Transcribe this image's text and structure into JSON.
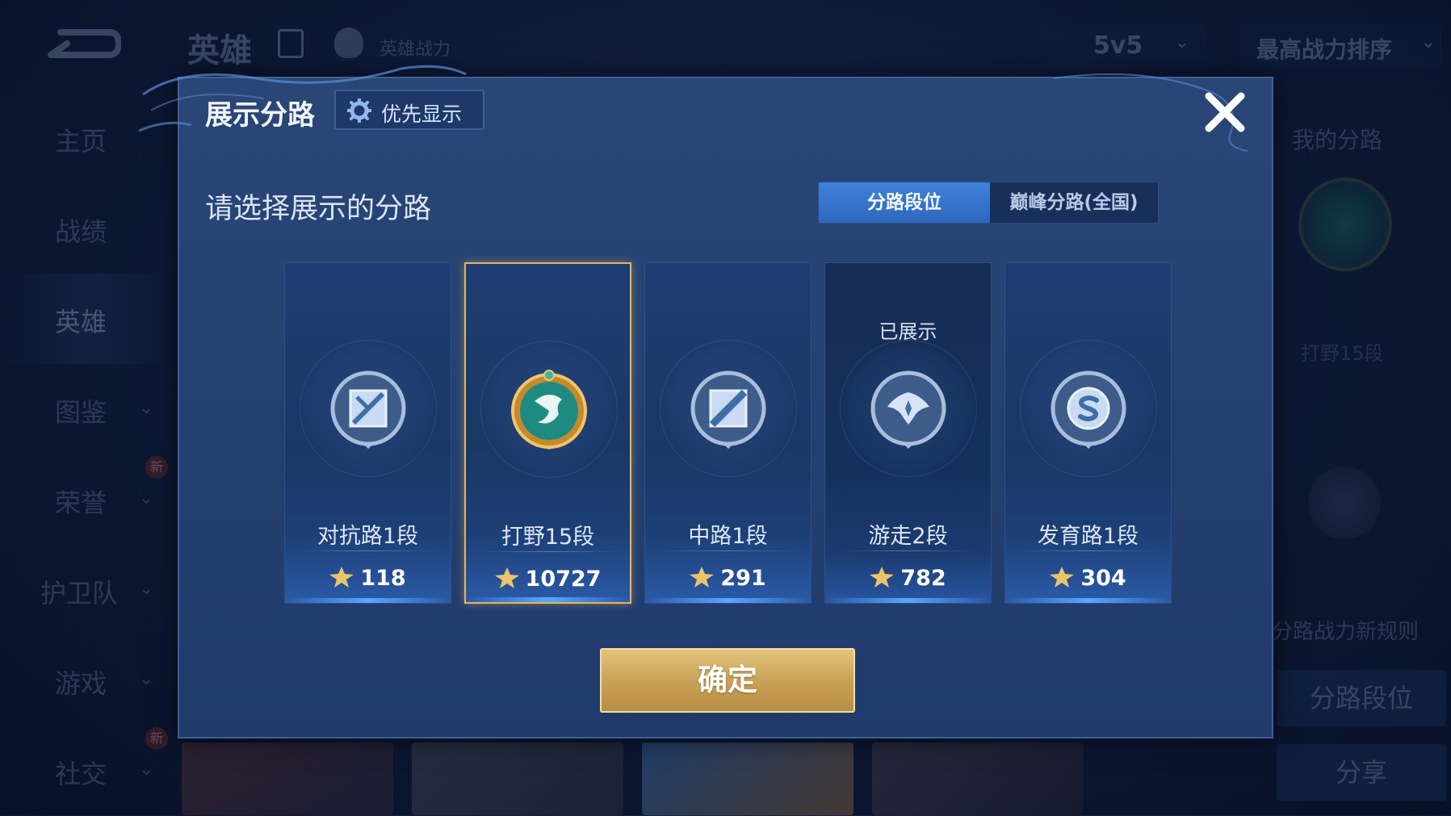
{
  "background": {
    "top_title": "英雄",
    "top_subtitle": "英雄战力",
    "mode_select": "5v5",
    "sort_select": "最高战力排序",
    "nav": [
      {
        "label": "主页",
        "chevron": false,
        "new": false,
        "active": false
      },
      {
        "label": "战绩",
        "chevron": false,
        "new": false,
        "active": false
      },
      {
        "label": "英雄",
        "chevron": false,
        "new": false,
        "active": true
      },
      {
        "label": "图鉴",
        "chevron": true,
        "new": false,
        "active": false
      },
      {
        "label": "荣誉",
        "chevron": true,
        "new": true,
        "active": false
      },
      {
        "label": "护卫队",
        "chevron": true,
        "new": false,
        "active": false
      },
      {
        "label": "游戏",
        "chevron": true,
        "new": false,
        "active": false
      },
      {
        "label": "社交",
        "chevron": true,
        "new": true,
        "active": false
      }
    ],
    "new_badge": "新",
    "right_panel": {
      "title": "我的分路",
      "rank": "打野15段",
      "rule_text": "分路战力新规则",
      "lane_rank_button": "分路段位",
      "share_button": "分享"
    }
  },
  "modal": {
    "title": "展示分路",
    "priority_button": "优先显示",
    "prompt": "请选择展示的分路",
    "tabs": [
      {
        "label": "分路段位",
        "active": true
      },
      {
        "label": "巅峰分路(全国)",
        "active": false
      }
    ],
    "shown_label": "已展示",
    "lanes": [
      {
        "name": "对抗路1段",
        "score": "118",
        "icon": "clash-lane-icon",
        "selected": false,
        "shown": false
      },
      {
        "name": "打野15段",
        "score": "10727",
        "icon": "jungle-dragon-icon",
        "selected": true,
        "shown": false
      },
      {
        "name": "中路1段",
        "score": "291",
        "icon": "mid-lane-icon",
        "selected": false,
        "shown": false
      },
      {
        "name": "游走2段",
        "score": "782",
        "icon": "roam-wings-icon",
        "selected": false,
        "shown": true
      },
      {
        "name": "发育路1段",
        "score": "304",
        "icon": "farm-lane-icon",
        "selected": false,
        "shown": false
      }
    ],
    "confirm_button": "确定"
  },
  "colors": {
    "accent_blue": "#2d67bd",
    "selected_border": "#e6b45c",
    "confirm_gold": "#c9a257"
  }
}
